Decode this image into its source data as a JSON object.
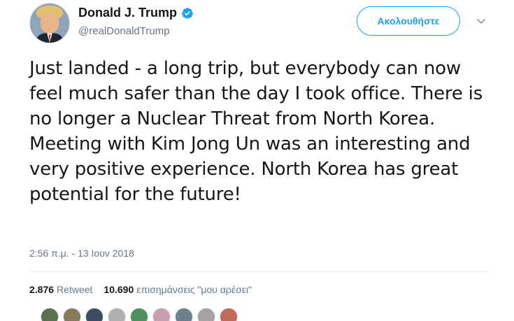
{
  "header": {
    "display_name": "Donald J. Trump",
    "handle": "@realDonaldTrump",
    "follow_label": "Ακολουθήστε",
    "verified_icon": "verified-badge-icon",
    "menu_icon": "chevron-down-icon"
  },
  "tweet": {
    "text": "Just landed - a long trip, but everybody can now feel much safer than the day I took office. There is no longer a Nuclear Threat from North Korea. Meeting with Kim Jong Un was an interesting and very positive experience. North Korea has great potential for the future!",
    "timestamp": "2:56 π.μ. - 13 Ιουν 2018"
  },
  "stats": {
    "retweets_count": "2.876",
    "retweets_label": "Retweet",
    "likes_count": "10.690",
    "likes_label": "επισημάνσεις \"μου αρέσει\""
  },
  "colors": {
    "accent": "#1da1f2",
    "text": "#14171a",
    "secondary": "#657786"
  },
  "liker_avatars": [
    "#5a6f4e",
    "#8a7a5c",
    "#3d4c63",
    "#b0b0b0",
    "#4f8f5a",
    "#c9a0b0",
    "#6f7f8f",
    "#a3a3a3",
    "#c46a5a"
  ]
}
